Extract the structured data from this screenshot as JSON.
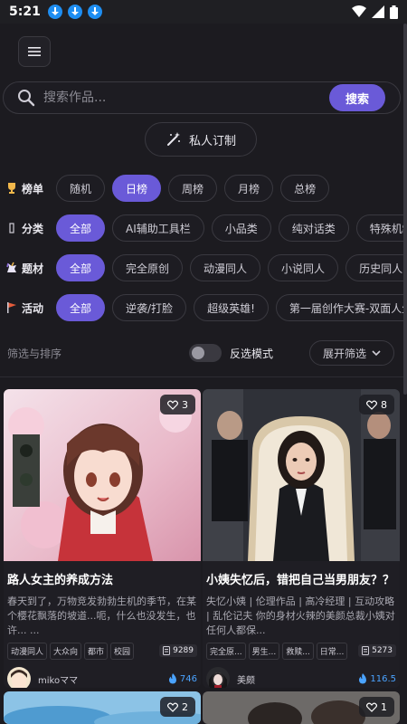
{
  "status": {
    "time": "5:21"
  },
  "search": {
    "placeholder": "搜索作品...",
    "button_label": "搜索"
  },
  "custom_order": {
    "label": "私人订制"
  },
  "filters": {
    "ranking": {
      "label": "榜单",
      "chips": [
        "随机",
        "日榜",
        "周榜",
        "月榜",
        "总榜"
      ],
      "active": "日榜"
    },
    "category": {
      "label": "分类",
      "chips": [
        "全部",
        "AI辅助工具栏",
        "小品类",
        "纯对话类",
        "特殊机制类"
      ],
      "active": "全部"
    },
    "theme": {
      "label": "题材",
      "chips": [
        "全部",
        "完全原创",
        "动漫同人",
        "小说同人",
        "历史同人"
      ],
      "active": "全部"
    },
    "event": {
      "label": "活动",
      "chips": [
        "全部",
        "逆袭/打脸",
        "超级英雄!",
        "第一届创作大赛-双面人生"
      ],
      "active": "全部"
    }
  },
  "sort": {
    "label": "筛选与排序",
    "reverse_label": "反选模式",
    "reverse_on": false,
    "expand_label": "展开筛选"
  },
  "cards": [
    {
      "likes": "3",
      "title": "路人女主的养成方法",
      "description": "春天到了，万物竞发勃勃生机的季节，在某个樱花飘落的坡道...呃，什么也没发生，也许... ...",
      "tags": [
        "动漫同人",
        "大众向",
        "都市",
        "校园"
      ],
      "word_count": "9289",
      "author": "mikoママ",
      "views": "746"
    },
    {
      "likes": "8",
      "title": "小姨失忆后，错把自己当男朋友？？",
      "description": "失忆小姨 | 伦理作品 | 高冷经理 | 互动攻略 | 乱伦记夫 你的身材火辣的美颜总裁小姨对任何人都保...",
      "tags": [
        "完全原...",
        "男生...",
        "救赎...",
        "日常..."
      ],
      "word_count": "5273",
      "author": "美颇",
      "views": "116.5"
    },
    {
      "likes": "2"
    },
    {
      "likes": "1"
    }
  ]
}
